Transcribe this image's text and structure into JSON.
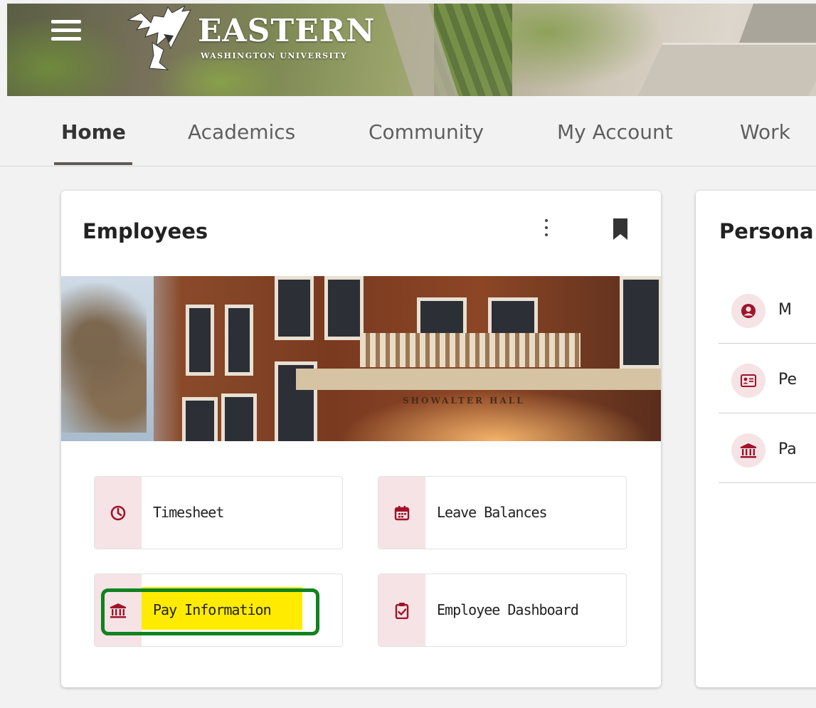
{
  "header": {
    "logo_word": "EASTERN",
    "logo_sub": "WASHINGTON UNIVERSITY",
    "menu_icon": "hamburger-menu-icon"
  },
  "tabs": [
    {
      "label": "Home",
      "active": true
    },
    {
      "label": "Academics",
      "active": false
    },
    {
      "label": "Community",
      "active": false
    },
    {
      "label": "My Account",
      "active": false
    },
    {
      "label": "Work",
      "active": false
    }
  ],
  "employees_card": {
    "title": "Employees",
    "photo_sign": "SHOWALTER HALL",
    "links": [
      {
        "label": "Timesheet",
        "icon": "clock-icon"
      },
      {
        "label": "Leave Balances",
        "icon": "calendar-icon"
      },
      {
        "label": "Pay Information",
        "icon": "bank-icon"
      },
      {
        "label": "Employee Dashboard",
        "icon": "clipboard-check-icon"
      }
    ]
  },
  "personal_card": {
    "title": "Persona",
    "items": [
      {
        "label": "M",
        "icon": "user-circle-icon"
      },
      {
        "label": "Pe",
        "icon": "id-card-icon"
      },
      {
        "label": "Pa",
        "icon": "bank-icon"
      }
    ]
  },
  "colors": {
    "accent": "#a0132a",
    "icon_bg": "#f5e3e5",
    "highlight": "#ffeb00",
    "annotation": "#10821f"
  }
}
